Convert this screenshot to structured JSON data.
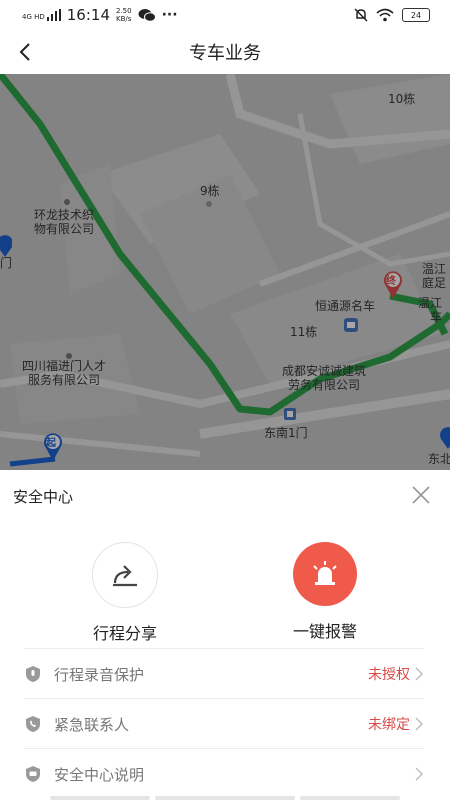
{
  "status_bar": {
    "network": "4G HD",
    "time": "16:14",
    "speed_value": "2.50",
    "speed_unit": "KB/s",
    "more": "···",
    "battery": "24"
  },
  "header": {
    "title": "专车业务"
  },
  "map": {
    "pois": [
      "10栋",
      "9栋",
      "环龙技术织",
      "物有限公司",
      "门",
      "温江",
      "庭足",
      "恒通源名车",
      "温江",
      "车",
      "11栋",
      "四川福进门人才",
      "服务有限公司",
      "成都安诚诚建筑",
      "劳务有限公司",
      "东南1门",
      "东北"
    ],
    "start_marker": "起",
    "end_marker": "终",
    "colors": {
      "route": "#2ea34a",
      "start": "#1e63d6",
      "end": "#e24d4d"
    }
  },
  "safety_sheet": {
    "title": "安全中心",
    "share_label": "行程分享",
    "alarm_label": "一键报警",
    "rows": [
      {
        "label": "行程录音保护",
        "status": "未授权"
      },
      {
        "label": "紧急联系人",
        "status": "未绑定"
      },
      {
        "label": "安全中心说明",
        "status": ""
      }
    ],
    "colors": {
      "alarm": "#f05a4a",
      "status": "#d84a4a"
    }
  }
}
